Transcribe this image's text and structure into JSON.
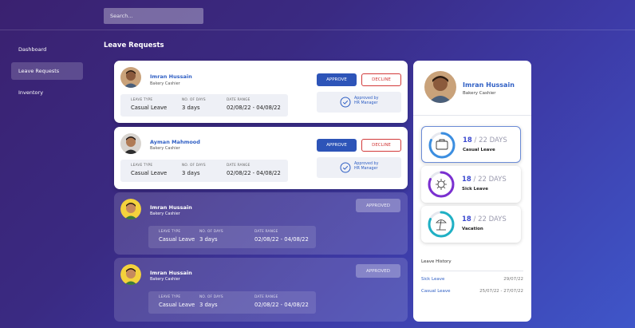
{
  "search": {
    "placeholder": "Search..."
  },
  "sidebar": {
    "items": [
      {
        "label": "Dashboard"
      },
      {
        "label": "Leave Requests"
      },
      {
        "label": "Inventory"
      }
    ]
  },
  "page_title": "Leave Requests",
  "columns": {
    "leave_type": "LEAVE TYPE",
    "no_of_days": "NO. OF DAYS",
    "date_range": "DATE RANGE"
  },
  "requests": [
    {
      "name": "Imran Hussain",
      "role": "Bakery Cashier",
      "leave_type": "Casual Leave",
      "days": "3 days",
      "dates": "02/08/22  -  04/08/22",
      "approve_label": "APPROVE",
      "decline_label": "DECLINE",
      "approved_by_1": "Approved by",
      "approved_by_2": "HR Manager"
    },
    {
      "name": "Ayman Mahmood",
      "role": "Bakery Cashier",
      "leave_type": "Casual Leave",
      "days": "3 days",
      "dates": "02/08/22  -  04/08/22",
      "approve_label": "APPROVE",
      "decline_label": "DECLINE",
      "approved_by_1": "Approved by",
      "approved_by_2": "HR Manager"
    },
    {
      "name": "Imran Hussain",
      "role": "Bakery Cashier",
      "leave_type": "Casual Leave",
      "days": "3 days",
      "dates": "02/08/22  -  04/08/22",
      "status_label": "APPROVED"
    },
    {
      "name": "Imran Hussain",
      "role": "Bakery Cashier",
      "leave_type": "Casual Leave",
      "days": "3 days",
      "dates": "02/08/22  -  04/08/22",
      "status_label": "APPROVED"
    }
  ],
  "profile": {
    "name": "Imran Hussain",
    "role": "Bakery Cashier",
    "balances": [
      {
        "used": "18",
        "total": "/ 22 DAYS",
        "type": "Casual Leave",
        "color": "#3b8ee0",
        "fraction": 0.82,
        "icon": "briefcase-icon"
      },
      {
        "used": "18",
        "total": "/ 22 DAYS",
        "type": "Sick Leave",
        "color": "#7a2fd0",
        "fraction": 0.82,
        "icon": "virus-icon"
      },
      {
        "used": "18",
        "total": "/ 22 DAYS",
        "type": "Vacation",
        "color": "#1fb0c4",
        "fraction": 0.82,
        "icon": "beach-icon"
      }
    ],
    "history_title": "Leave History",
    "history": [
      {
        "type": "Sick Leave",
        "dates": "29/07/22"
      },
      {
        "type": "Casual Leave",
        "dates": "25/07/22  -  27/07/22"
      }
    ]
  }
}
